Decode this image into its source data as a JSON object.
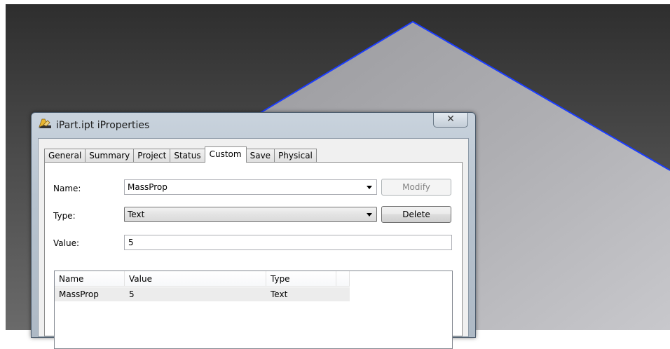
{
  "window": {
    "title": "iPart.ipt iProperties",
    "close_glyph": "✕"
  },
  "tabs": [
    {
      "label": "General"
    },
    {
      "label": "Summary"
    },
    {
      "label": "Project"
    },
    {
      "label": "Status"
    },
    {
      "label": "Custom",
      "active": true
    },
    {
      "label": "Save"
    },
    {
      "label": "Physical"
    }
  ],
  "form": {
    "name_label": "Name:",
    "name_value": "MassProp",
    "type_label": "Type:",
    "type_value": "Text",
    "value_label": "Value:",
    "value_value": "5",
    "modify_label": "Modify",
    "delete_label": "Delete"
  },
  "table": {
    "columns": [
      "Name",
      "Value",
      "Type",
      ""
    ],
    "rows": [
      {
        "name": "MassProp",
        "value": "5",
        "type": "Text"
      }
    ]
  },
  "colors": {
    "model_edge": "#1a3cff",
    "model_face": "#a0a0a4"
  }
}
